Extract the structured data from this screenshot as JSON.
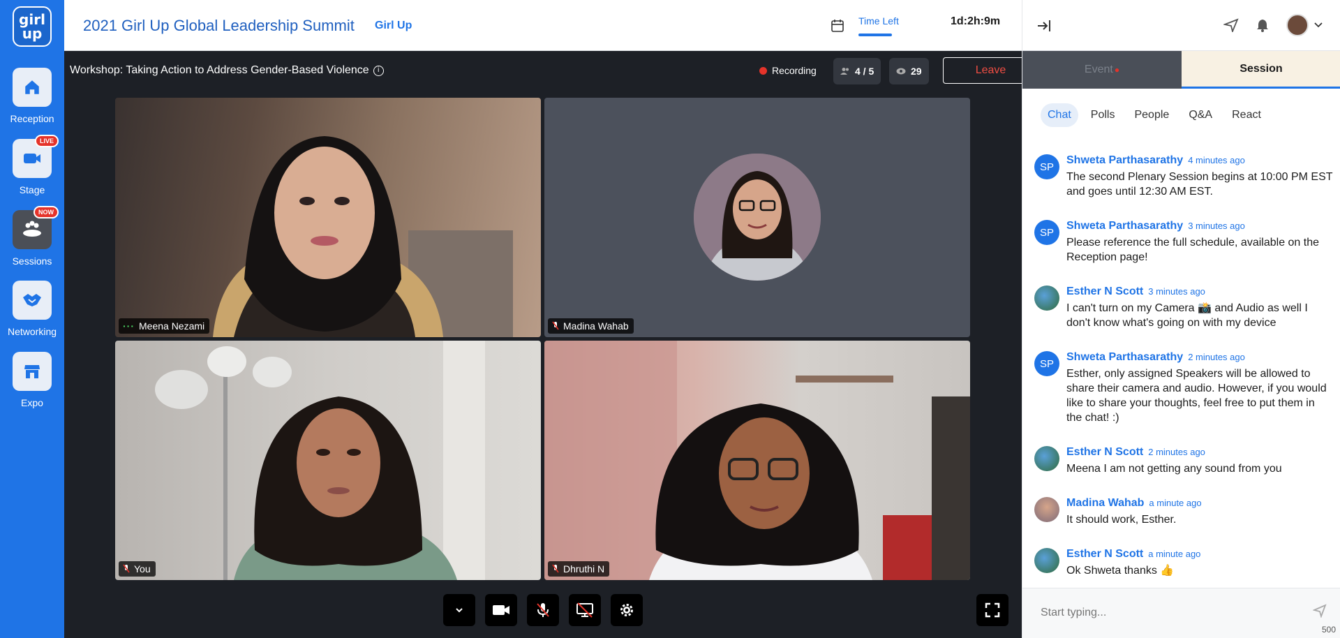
{
  "logo": {
    "text": "girl up"
  },
  "rail": [
    {
      "label": "Reception",
      "icon": "home-icon"
    },
    {
      "label": "Stage",
      "icon": "video-camera-icon",
      "badge": "LIVE"
    },
    {
      "label": "Sessions",
      "icon": "roundtable-icon",
      "badge": "NOW"
    },
    {
      "label": "Networking",
      "icon": "handshake-icon"
    },
    {
      "label": "Expo",
      "icon": "store-icon"
    }
  ],
  "header": {
    "title": "2021 Girl Up Global Leadership Summit",
    "org": "Girl Up",
    "time_left_label": "Time Left",
    "countdown": "1d:2h:9m"
  },
  "stage": {
    "session_title": "Workshop: Taking Action to Address Gender-Based Violence",
    "recording_label": "Recording",
    "participants": "4 / 5",
    "viewers": "29",
    "leave_label": "Leave"
  },
  "tiles": [
    {
      "name": "Meena Nezami",
      "status": "speaking-dots-icon"
    },
    {
      "name": "Madina Wahab",
      "status": "mic-muted-icon"
    },
    {
      "name": "You",
      "status": "mic-muted-icon"
    },
    {
      "name": "Dhruthi N",
      "status": "mic-muted-icon"
    }
  ],
  "controls": [
    "chevron-down-icon",
    "camera-icon",
    "mic-off-icon",
    "screen-share-off-icon",
    "settings-icon"
  ],
  "panel": {
    "tab_event": "Event",
    "tab_session": "Session",
    "subtabs": [
      "Chat",
      "Polls",
      "People",
      "Q&A",
      "React"
    ],
    "messages": [
      {
        "avatar": "SP",
        "name": "Shweta Parthasarathy",
        "time": "4 minutes ago",
        "text": "The second Plenary Session begins at 10:00 PM EST and goes until 12:30 AM EST."
      },
      {
        "avatar": "SP",
        "name": "Shweta Parthasarathy",
        "time": "3 minutes ago",
        "text": "Please reference the full schedule, available on the Reception page!"
      },
      {
        "avatar": "",
        "name": "Esther N Scott",
        "time": "3 minutes ago",
        "text": "I can't turn on my Camera 📸 and Audio as well I don't know what's going on with my device"
      },
      {
        "avatar": "SP",
        "name": "Shweta Parthasarathy",
        "time": "2 minutes ago",
        "text": "Esther, only assigned Speakers will be allowed to share their camera and audio. However, if you would like to share your thoughts, feel free to put them in the chat! :)"
      },
      {
        "avatar": "",
        "name": "Esther N Scott",
        "time": "2 minutes ago",
        "text": "Meena I am not getting any sound from you"
      },
      {
        "avatar": "",
        "name": "Madina Wahab",
        "time": "a minute ago",
        "text": "It should work, Esther."
      },
      {
        "avatar": "",
        "name": "Esther N Scott",
        "time": "a minute ago",
        "text": "Ok Shweta thanks 👍"
      }
    ],
    "composer_placeholder": "Start typing...",
    "char_count": "500"
  },
  "colors": {
    "brand": "#1f74e6",
    "stage_bg": "#1d2026",
    "live_badge": "#e5332a"
  }
}
